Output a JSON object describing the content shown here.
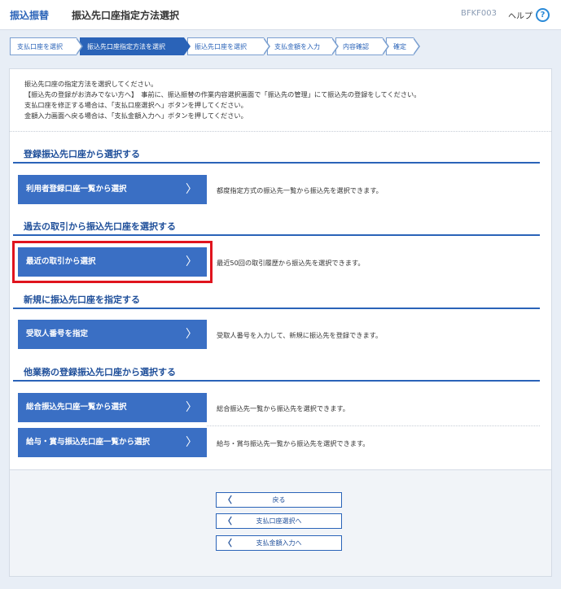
{
  "header": {
    "section": "振込振替",
    "title": "振込先口座指定方法選択",
    "screen_id": "BFKF003",
    "help_label": "ヘルプ",
    "help_icon": "?"
  },
  "steps": [
    {
      "label": "支払口座を選択"
    },
    {
      "label": "振込先口座指定方法を選択"
    },
    {
      "label": "振込先口座を選択"
    },
    {
      "label": "支払金額を入力"
    },
    {
      "label": "内容確認"
    },
    {
      "label": "確定"
    }
  ],
  "info_lines": [
    "振込先口座の指定方法を選択してください。",
    "【振込先の登録がお済みでない方へ】　事前に、振込振替の作業内容選択画面で「振込先の管理」にて振込先の登録をしてください。",
    "支払口座を修正する場合は、「支払口座選択へ」ボタンを押してください。",
    "金額入力画面へ戻る場合は、「支払金額入力へ」ボタンを押してください。"
  ],
  "sections": {
    "registered": {
      "title": "登録振込先口座から選択する",
      "button": "利用者登録口座一覧から選択",
      "desc": "都度指定方式の振込先一覧から振込先を選択できます。"
    },
    "history": {
      "title": "過去の取引から振込先口座を選択する",
      "button": "最近の取引から選択",
      "desc": "最近50回の取引履歴から振込先を選択できます。"
    },
    "new": {
      "title": "新規に振込先口座を指定する",
      "button": "受取人番号を指定",
      "desc": "受取人番号を入力して、新規に振込先を登録できます。"
    },
    "other": {
      "title": "他業務の登録振込先口座から選択する",
      "button1": "総合振込先口座一覧から選択",
      "desc1": "総合振込先一覧から振込先を選択できます。",
      "button2": "給与・賞与振込先口座一覧から選択",
      "desc2": "給与・賞与振込先一覧から振込先を選択できます。"
    }
  },
  "bottom_buttons": {
    "back": "戻る",
    "to_payment_account": "支払口座選択へ",
    "to_amount_input": "支払金額入力へ"
  },
  "icons": {
    "chevron_right": "〉",
    "chevron_left": "〈"
  },
  "colors": {
    "primary": "#2a63b8",
    "button": "#3a6fc4",
    "highlight": "#e0141e"
  }
}
